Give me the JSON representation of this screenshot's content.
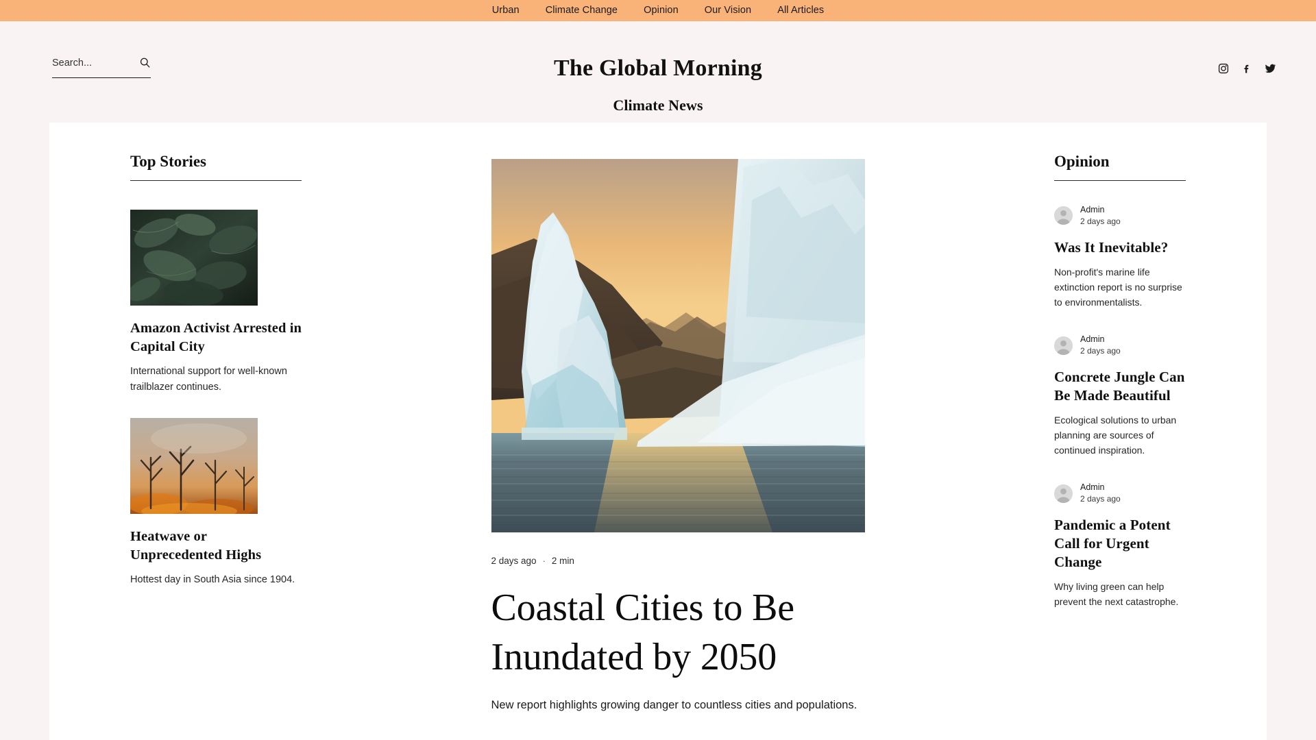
{
  "nav": {
    "items": [
      {
        "label": "Urban"
      },
      {
        "label": "Climate Change"
      },
      {
        "label": "Opinion"
      },
      {
        "label": "Our Vision"
      },
      {
        "label": "All Articles"
      }
    ]
  },
  "header": {
    "search": {
      "placeholder": "Search...",
      "value": "",
      "icon": "search-icon"
    },
    "brand_title": "The Global Morning",
    "brand_subtitle": "Climate News",
    "social": [
      {
        "name": "instagram-icon"
      },
      {
        "name": "facebook-icon"
      },
      {
        "name": "twitter-icon"
      }
    ]
  },
  "left_column": {
    "heading": "Top Stories",
    "stories": [
      {
        "image_alt": "dark tropical leaves photograph",
        "title": "Amazon Activist Arrested in Capital City",
        "excerpt": "International support for well-known trailblazer continues."
      },
      {
        "image_alt": "wildfire smoke over burning trees photograph",
        "title": "Heatwave or Unprecedented Highs",
        "excerpt": "Hottest day in South Asia since 1904."
      }
    ]
  },
  "feature": {
    "image_alt": "iceberg at sunset in arctic fjord photograph",
    "date": "2 days ago",
    "separator": "·",
    "read_time": "2 min",
    "title": "Coastal Cities to Be Inundated by 2050",
    "subtitle": "New report highlights growing danger to countless cities and populations."
  },
  "right_column": {
    "heading": "Opinion",
    "items": [
      {
        "author": "Admin",
        "date": "2 days ago",
        "title": "Was It Inevitable?",
        "excerpt": "Non-profit's marine life extinction report is no surprise to environmentalists."
      },
      {
        "author": "Admin",
        "date": "2 days ago",
        "title": "Concrete Jungle Can Be Made Beautiful",
        "excerpt": "Ecological solutions to urban planning are sources of continued inspiration."
      },
      {
        "author": "Admin",
        "date": "2 days ago",
        "title": "Pandemic a Potent Call for Urgent Change",
        "excerpt": "Why living green can help prevent the next catastrophe."
      }
    ]
  },
  "colors": {
    "nav_bar": "#F9B277",
    "page_background": "#FAF3F3",
    "content_background": "#FFFFFF",
    "text": "#111111"
  }
}
